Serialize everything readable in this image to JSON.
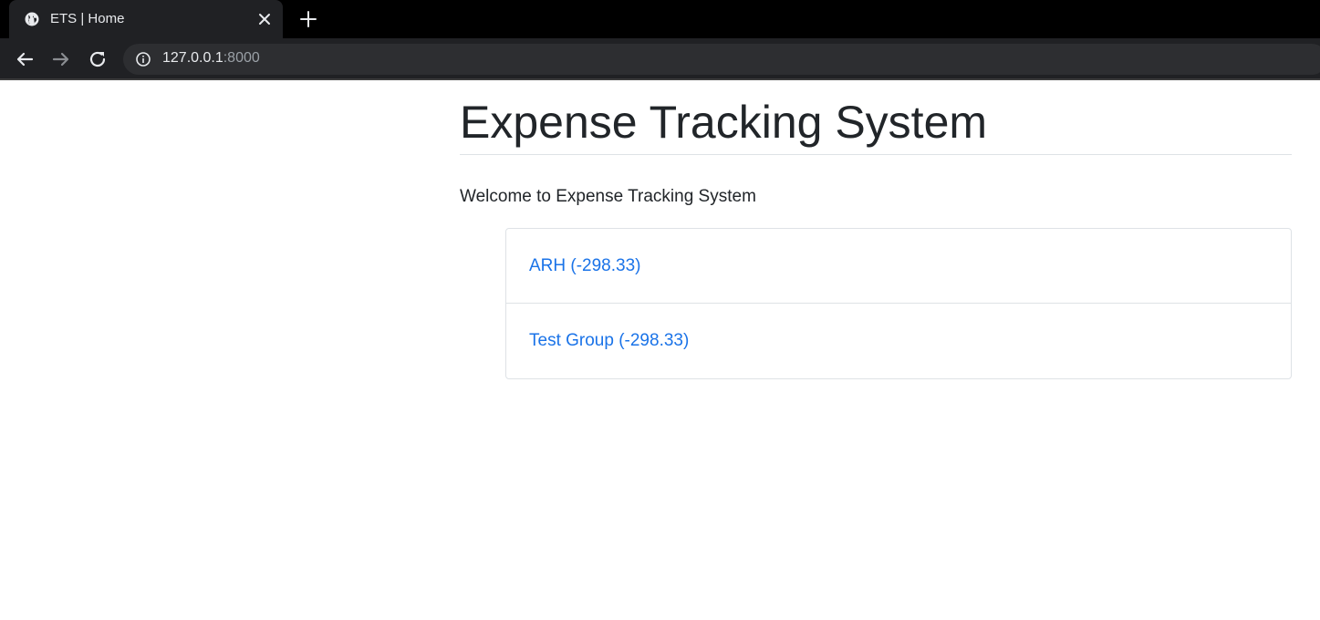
{
  "browser": {
    "tab": {
      "title": "ETS | Home",
      "favicon_icon": "globe-icon",
      "close_icon": "close-icon"
    },
    "new_tab_icon": "plus-icon",
    "nav": {
      "back_icon": "arrow-back-icon",
      "forward_icon": "arrow-forward-icon",
      "reload_icon": "reload-icon"
    },
    "address_bar": {
      "info_icon": "info-icon",
      "host": "127.0.0.1",
      "port": ":8000"
    }
  },
  "page": {
    "title": "Expense Tracking System",
    "welcome_text": "Welcome to Expense Tracking System",
    "groups": [
      {
        "label": "ARH (-298.33)"
      },
      {
        "label": "Test Group (-298.33)"
      }
    ]
  },
  "colors": {
    "link": "#1a73e8",
    "text": "#212529",
    "chrome_bg": "#202124"
  }
}
